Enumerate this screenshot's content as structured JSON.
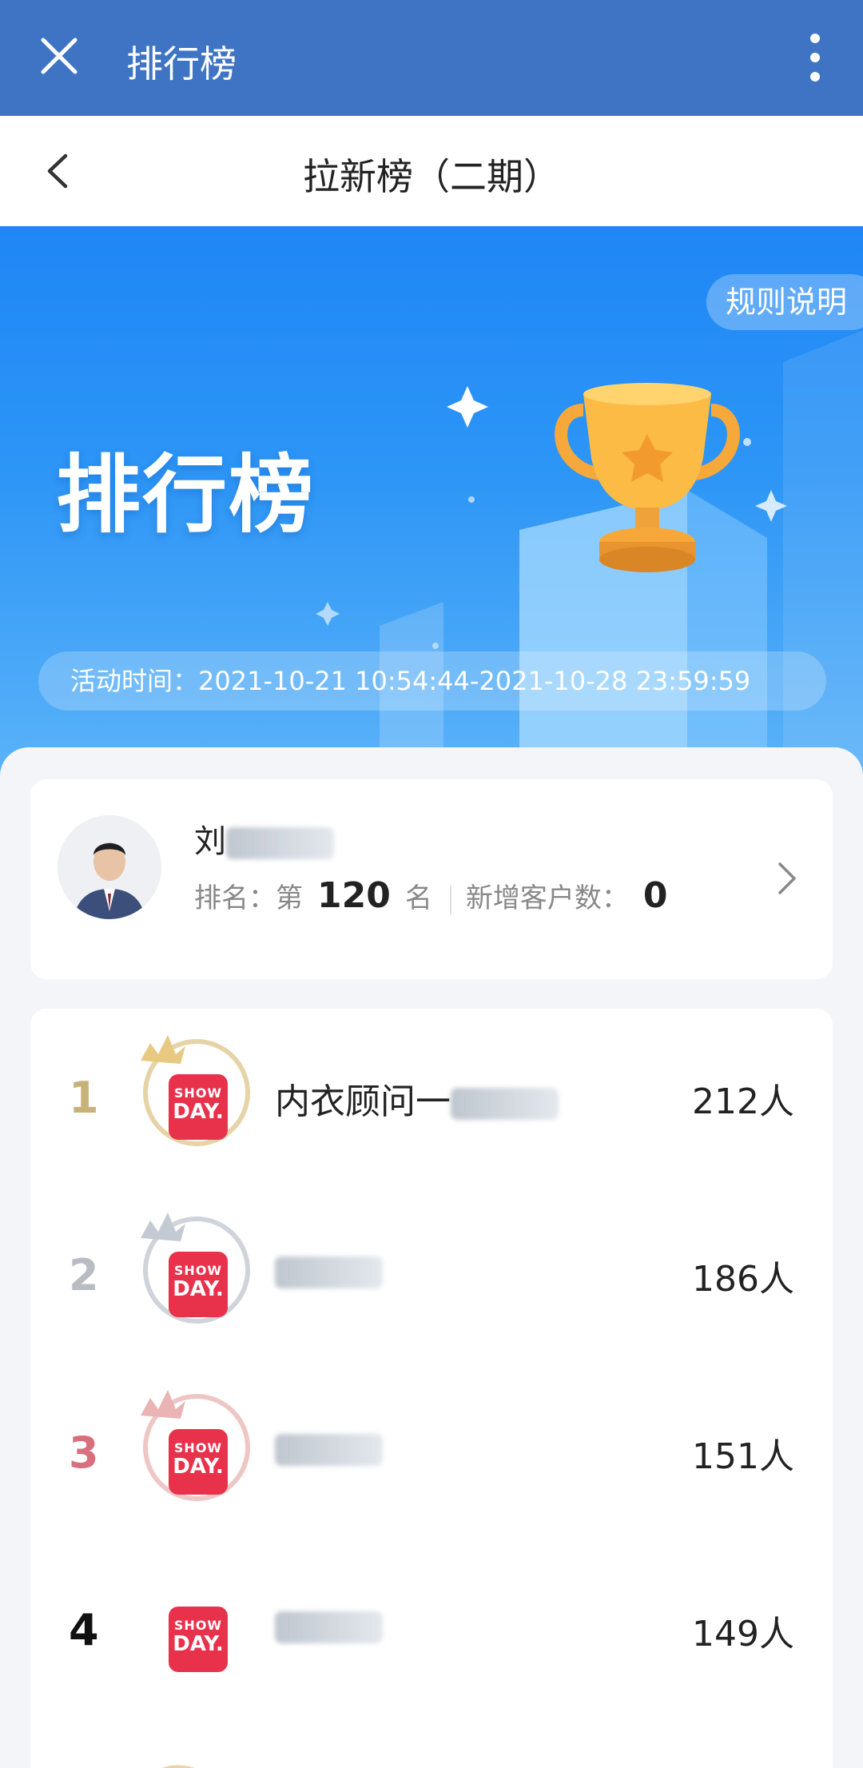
{
  "appbar": {
    "title": "排行榜"
  },
  "header": {
    "title": "拉新榜（二期）"
  },
  "banner": {
    "title": "排行榜",
    "rules_button": "规则说明",
    "activity_label": "活动时间：",
    "activity_time": "2021-10-21 10:54:44-2021-10-28 23:59:59"
  },
  "me": {
    "name": "刘",
    "rank_label": "排名：",
    "rank_prefix": "第",
    "rank": "120",
    "rank_suffix": "名",
    "new_label": "新增客户数：",
    "new_count": "0"
  },
  "ranking": [
    {
      "rank": "1",
      "name": "内衣顾问一",
      "count": "212人",
      "rank_color": "#c9b27a"
    },
    {
      "rank": "2",
      "name": "",
      "count": "186人",
      "rank_color": "#b9bcc3"
    },
    {
      "rank": "3",
      "name": "",
      "count": "151人",
      "rank_color": "#d86f7d"
    },
    {
      "rank": "4",
      "name": "",
      "count": "149人",
      "rank_color": "#111111"
    }
  ],
  "brand_logo": {
    "line1": "SHOW",
    "line2": "DAY."
  },
  "colors": {
    "appbar": "#3f74c4",
    "banner": "#2d96f6",
    "logo": "#e8324c"
  }
}
